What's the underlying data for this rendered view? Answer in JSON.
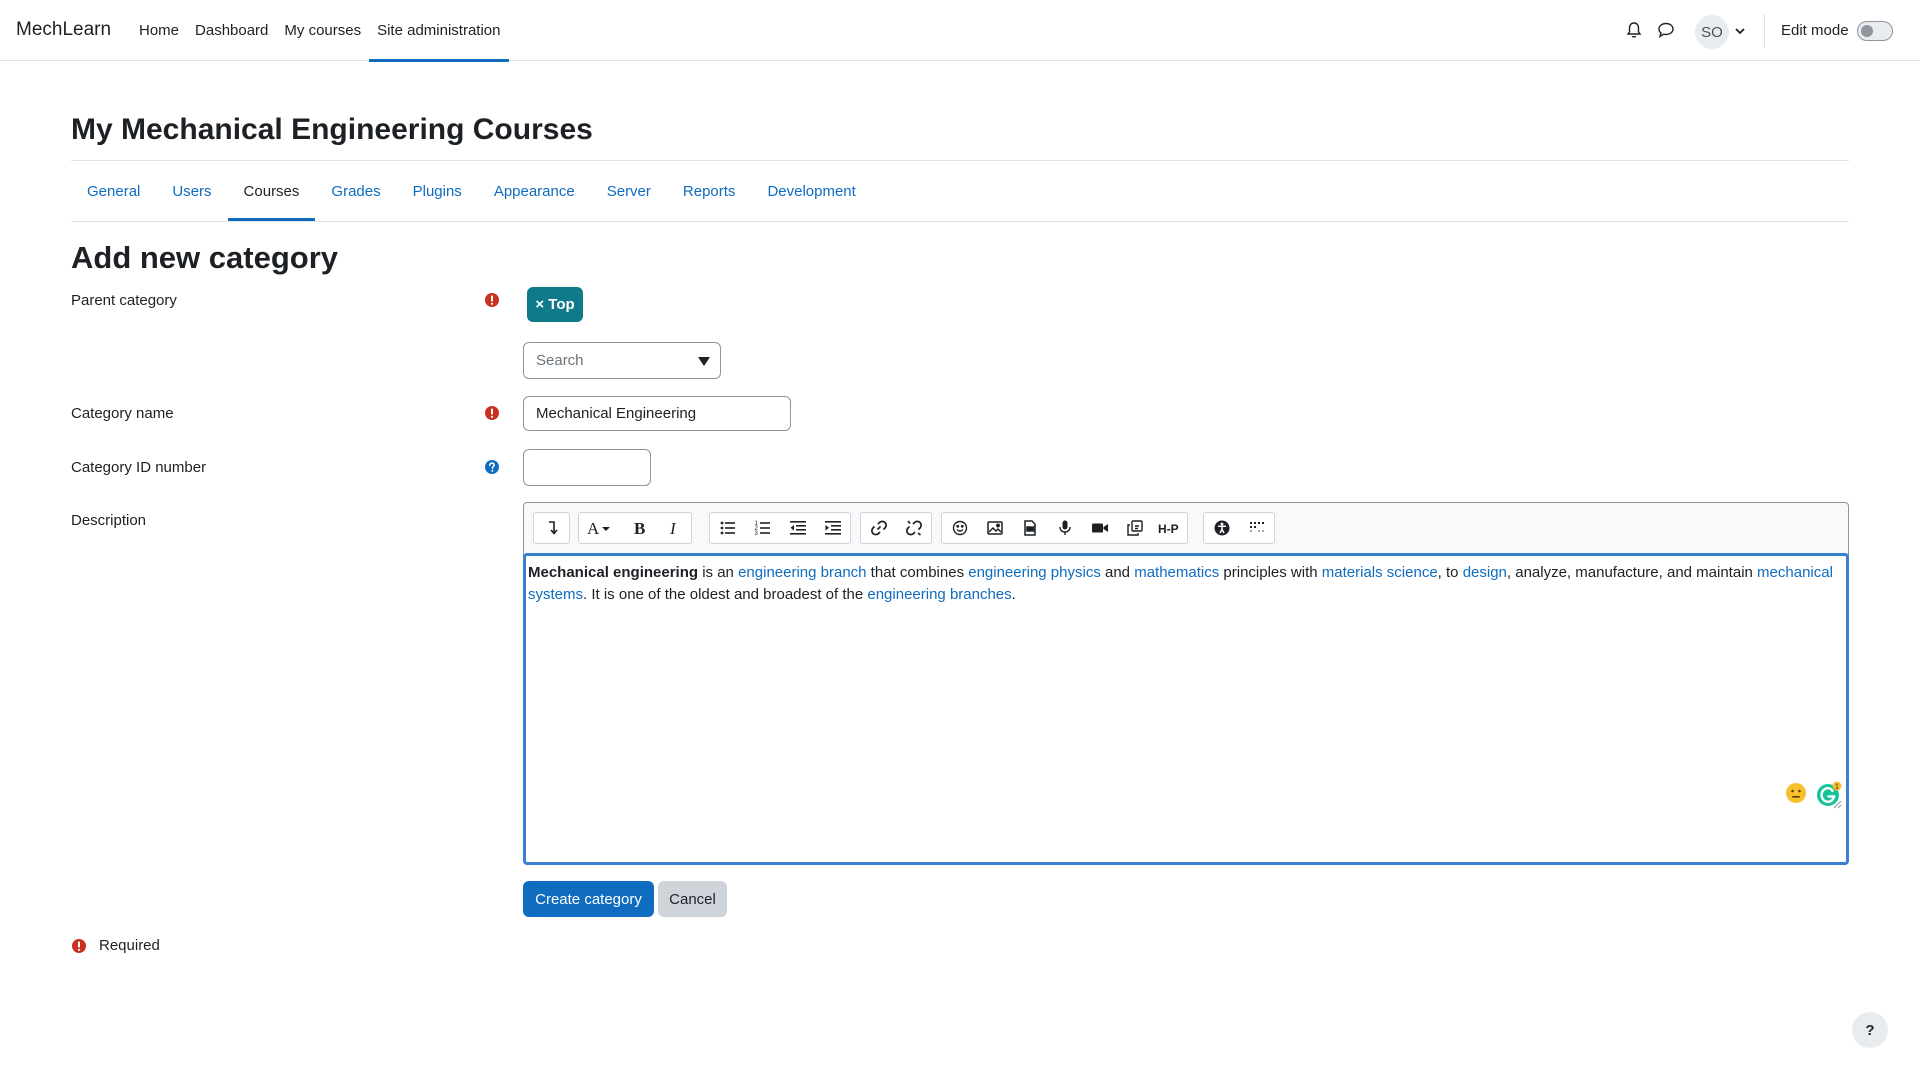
{
  "brand": "MechLearn",
  "primary_nav": [
    {
      "label": "Home"
    },
    {
      "label": "Dashboard"
    },
    {
      "label": "My courses"
    },
    {
      "label": "Site administration"
    }
  ],
  "user": {
    "initials": "SO"
  },
  "edit_mode": {
    "label": "Edit mode",
    "enabled": false
  },
  "page_title": "My Mechanical Engineering Courses",
  "secondary_nav": [
    {
      "label": "General"
    },
    {
      "label": "Users"
    },
    {
      "label": "Courses"
    },
    {
      "label": "Grades"
    },
    {
      "label": "Plugins"
    },
    {
      "label": "Appearance"
    },
    {
      "label": "Server"
    },
    {
      "label": "Reports"
    },
    {
      "label": "Development"
    }
  ],
  "active_tab": "Courses",
  "section_title": "Add new category",
  "form": {
    "parent_category": {
      "label": "Parent category",
      "selected_tag": "× Top",
      "search_placeholder": "Search"
    },
    "category_name": {
      "label": "Category name",
      "value": "Mechanical Engineering"
    },
    "category_id": {
      "label": "Category ID number",
      "value": ""
    },
    "description": {
      "label": "Description",
      "segments": [
        {
          "text": "Mechanical engineering",
          "style": "bold"
        },
        {
          "text": " is an ",
          "style": "plain"
        },
        {
          "text": "engineering branch",
          "style": "link"
        },
        {
          "text": " that combines ",
          "style": "plain"
        },
        {
          "text": "engineering physics",
          "style": "link"
        },
        {
          "text": " and ",
          "style": "plain"
        },
        {
          "text": "mathematics",
          "style": "link"
        },
        {
          "text": " principles with ",
          "style": "plain"
        },
        {
          "text": "materials science",
          "style": "link"
        },
        {
          "text": ", to ",
          "style": "plain"
        },
        {
          "text": "design",
          "style": "link"
        },
        {
          "text": ", analyze, manufacture, and maintain ",
          "style": "plain"
        },
        {
          "text": "mechanical systems",
          "style": "link"
        },
        {
          "text": ". It is one of the oldest and broadest of the ",
          "style": "plain"
        },
        {
          "text": "engineering branches",
          "style": "link"
        },
        {
          "text": ".",
          "style": "plain"
        }
      ]
    },
    "grammarly_badge": "1",
    "submit_label": "Create category",
    "cancel_label": "Cancel",
    "required_label": "Required"
  },
  "help_button": "?",
  "colors": {
    "accent": "#0f6cbf",
    "tag": "#0f7a8a",
    "required": "#ca3120",
    "help": "#0f6cbf"
  }
}
